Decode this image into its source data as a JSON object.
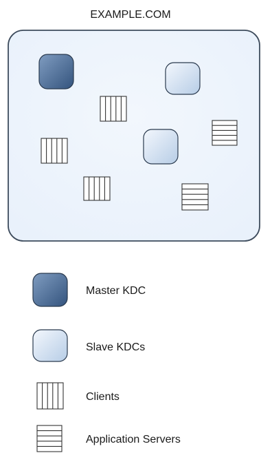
{
  "realm": {
    "name": "EXAMPLE.COM"
  },
  "nodes": [
    {
      "type": "master-kdc"
    },
    {
      "type": "slave-kdc"
    },
    {
      "type": "slave-kdc"
    },
    {
      "type": "client"
    },
    {
      "type": "client"
    },
    {
      "type": "client"
    },
    {
      "type": "application-server"
    },
    {
      "type": "application-server"
    }
  ],
  "legend": {
    "items": [
      {
        "type": "master-kdc",
        "label": "Master KDC"
      },
      {
        "type": "slave-kdc",
        "label": "Slave KDCs"
      },
      {
        "type": "client",
        "label": "Clients"
      },
      {
        "type": "application-server",
        "label": "Application Servers"
      }
    ]
  },
  "colors": {
    "realm_fill": "#e9f1fb",
    "realm_stroke": "#3d4b5c",
    "master_dark": "#34547e",
    "master_light": "#7f9cc0",
    "slave_dark": "#b7cde6",
    "slave_light": "#f3f7fd",
    "node_stroke": "#2a3a4e",
    "grid_fill": "#ffffff",
    "grid_stroke": "#333333"
  }
}
